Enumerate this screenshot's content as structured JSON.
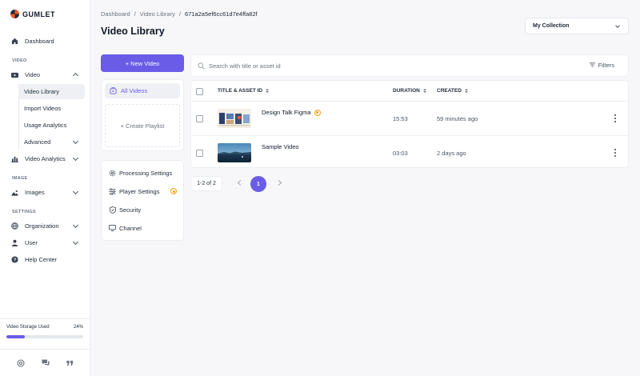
{
  "app": {
    "name": "GUMLET"
  },
  "sidebar": {
    "dashboard": "Dashboard",
    "sections": {
      "video": "VIDEO",
      "image": "IMAGE",
      "settings": "SETTINGS"
    },
    "video": "Video",
    "video_sub": [
      "Video Library",
      "Import Videos",
      "Usage Analytics",
      "Advanced"
    ],
    "video_analytics": "Video Analytics",
    "images": "Images",
    "organization": "Organization",
    "user": "User",
    "help": "Help Center",
    "storage": {
      "label": "Video Storage Used",
      "percent_text": "24%",
      "percent": 24
    }
  },
  "breadcrumb": {
    "root": "Dashboard",
    "section": "Video Library",
    "current": "671a2a5ef6cc61d7e4ffa82f",
    "sep": "/"
  },
  "page": {
    "title": "Video Library"
  },
  "collection_select": {
    "value": "My Collection"
  },
  "actions": {
    "new_video": "+ New Video"
  },
  "library_panel": {
    "all_videos": "All Videos",
    "create_playlist": "+ Create Playlist"
  },
  "settings_panel": {
    "processing": "Processing Settings",
    "player": "Player Settings",
    "security": "Security",
    "channel": "Channel"
  },
  "search": {
    "placeholder": "Search with title or asset id",
    "filters": "Filters"
  },
  "table": {
    "headers": {
      "title": "TITLE & ASSET ID",
      "duration": "DURATION",
      "created": "CREATED"
    },
    "rows": [
      {
        "title": "Design Talk Figma",
        "duration": "15:53",
        "created": "59 minutes ago"
      },
      {
        "title": "Sample Video",
        "duration": "03:03",
        "created": "2 days ago"
      }
    ]
  },
  "pagination": {
    "count": "1-2 of 2",
    "page": "1"
  },
  "colors": {
    "accent": "#6b5ce7",
    "warning": "#f59e0b",
    "brand": "#f05a28"
  }
}
